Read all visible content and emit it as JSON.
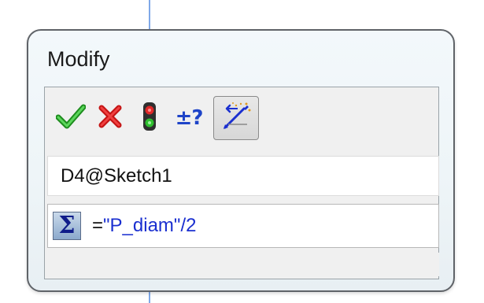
{
  "dialog": {
    "title": "Modify"
  },
  "toolbar": {
    "buttons": [
      {
        "icon": "checkmark-icon",
        "color": "#2ea12e"
      },
      {
        "icon": "x-icon",
        "color": "#e02020"
      },
      {
        "icon": "traffic-light-icon",
        "color": "#3a3a3a"
      },
      {
        "icon": "tolerance-icon",
        "label": "±?",
        "color": "#1e44c8"
      },
      {
        "icon": "mark-dimension-icon",
        "pressed": true
      }
    ]
  },
  "dimension": {
    "name": "D4@Sketch1"
  },
  "value": {
    "prefix": "=",
    "parameter": "\"P_diam\"",
    "suffix": "/2"
  },
  "colors": {
    "guide_line": "#7fa8e8",
    "equation_text": "#1a2fd0"
  }
}
